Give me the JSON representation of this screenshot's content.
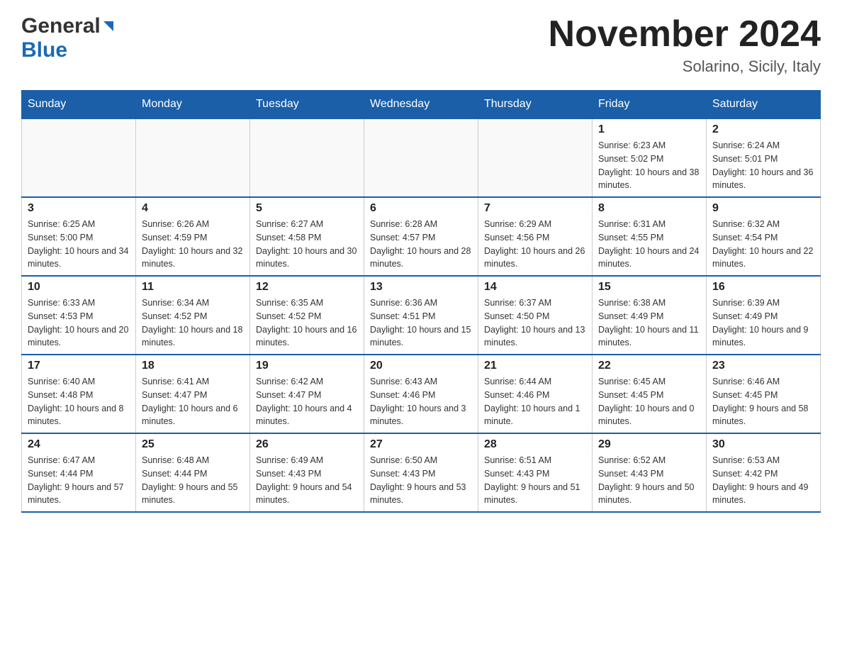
{
  "header": {
    "logo_general": "General",
    "logo_blue": "Blue",
    "month_title": "November 2024",
    "location": "Solarino, Sicily, Italy"
  },
  "weekdays": [
    "Sunday",
    "Monday",
    "Tuesday",
    "Wednesday",
    "Thursday",
    "Friday",
    "Saturday"
  ],
  "weeks": [
    [
      {
        "day": "",
        "sunrise": "",
        "sunset": "",
        "daylight": ""
      },
      {
        "day": "",
        "sunrise": "",
        "sunset": "",
        "daylight": ""
      },
      {
        "day": "",
        "sunrise": "",
        "sunset": "",
        "daylight": ""
      },
      {
        "day": "",
        "sunrise": "",
        "sunset": "",
        "daylight": ""
      },
      {
        "day": "",
        "sunrise": "",
        "sunset": "",
        "daylight": ""
      },
      {
        "day": "1",
        "sunrise": "Sunrise: 6:23 AM",
        "sunset": "Sunset: 5:02 PM",
        "daylight": "Daylight: 10 hours and 38 minutes."
      },
      {
        "day": "2",
        "sunrise": "Sunrise: 6:24 AM",
        "sunset": "Sunset: 5:01 PM",
        "daylight": "Daylight: 10 hours and 36 minutes."
      }
    ],
    [
      {
        "day": "3",
        "sunrise": "Sunrise: 6:25 AM",
        "sunset": "Sunset: 5:00 PM",
        "daylight": "Daylight: 10 hours and 34 minutes."
      },
      {
        "day": "4",
        "sunrise": "Sunrise: 6:26 AM",
        "sunset": "Sunset: 4:59 PM",
        "daylight": "Daylight: 10 hours and 32 minutes."
      },
      {
        "day": "5",
        "sunrise": "Sunrise: 6:27 AM",
        "sunset": "Sunset: 4:58 PM",
        "daylight": "Daylight: 10 hours and 30 minutes."
      },
      {
        "day": "6",
        "sunrise": "Sunrise: 6:28 AM",
        "sunset": "Sunset: 4:57 PM",
        "daylight": "Daylight: 10 hours and 28 minutes."
      },
      {
        "day": "7",
        "sunrise": "Sunrise: 6:29 AM",
        "sunset": "Sunset: 4:56 PM",
        "daylight": "Daylight: 10 hours and 26 minutes."
      },
      {
        "day": "8",
        "sunrise": "Sunrise: 6:31 AM",
        "sunset": "Sunset: 4:55 PM",
        "daylight": "Daylight: 10 hours and 24 minutes."
      },
      {
        "day": "9",
        "sunrise": "Sunrise: 6:32 AM",
        "sunset": "Sunset: 4:54 PM",
        "daylight": "Daylight: 10 hours and 22 minutes."
      }
    ],
    [
      {
        "day": "10",
        "sunrise": "Sunrise: 6:33 AM",
        "sunset": "Sunset: 4:53 PM",
        "daylight": "Daylight: 10 hours and 20 minutes."
      },
      {
        "day": "11",
        "sunrise": "Sunrise: 6:34 AM",
        "sunset": "Sunset: 4:52 PM",
        "daylight": "Daylight: 10 hours and 18 minutes."
      },
      {
        "day": "12",
        "sunrise": "Sunrise: 6:35 AM",
        "sunset": "Sunset: 4:52 PM",
        "daylight": "Daylight: 10 hours and 16 minutes."
      },
      {
        "day": "13",
        "sunrise": "Sunrise: 6:36 AM",
        "sunset": "Sunset: 4:51 PM",
        "daylight": "Daylight: 10 hours and 15 minutes."
      },
      {
        "day": "14",
        "sunrise": "Sunrise: 6:37 AM",
        "sunset": "Sunset: 4:50 PM",
        "daylight": "Daylight: 10 hours and 13 minutes."
      },
      {
        "day": "15",
        "sunrise": "Sunrise: 6:38 AM",
        "sunset": "Sunset: 4:49 PM",
        "daylight": "Daylight: 10 hours and 11 minutes."
      },
      {
        "day": "16",
        "sunrise": "Sunrise: 6:39 AM",
        "sunset": "Sunset: 4:49 PM",
        "daylight": "Daylight: 10 hours and 9 minutes."
      }
    ],
    [
      {
        "day": "17",
        "sunrise": "Sunrise: 6:40 AM",
        "sunset": "Sunset: 4:48 PM",
        "daylight": "Daylight: 10 hours and 8 minutes."
      },
      {
        "day": "18",
        "sunrise": "Sunrise: 6:41 AM",
        "sunset": "Sunset: 4:47 PM",
        "daylight": "Daylight: 10 hours and 6 minutes."
      },
      {
        "day": "19",
        "sunrise": "Sunrise: 6:42 AM",
        "sunset": "Sunset: 4:47 PM",
        "daylight": "Daylight: 10 hours and 4 minutes."
      },
      {
        "day": "20",
        "sunrise": "Sunrise: 6:43 AM",
        "sunset": "Sunset: 4:46 PM",
        "daylight": "Daylight: 10 hours and 3 minutes."
      },
      {
        "day": "21",
        "sunrise": "Sunrise: 6:44 AM",
        "sunset": "Sunset: 4:46 PM",
        "daylight": "Daylight: 10 hours and 1 minute."
      },
      {
        "day": "22",
        "sunrise": "Sunrise: 6:45 AM",
        "sunset": "Sunset: 4:45 PM",
        "daylight": "Daylight: 10 hours and 0 minutes."
      },
      {
        "day": "23",
        "sunrise": "Sunrise: 6:46 AM",
        "sunset": "Sunset: 4:45 PM",
        "daylight": "Daylight: 9 hours and 58 minutes."
      }
    ],
    [
      {
        "day": "24",
        "sunrise": "Sunrise: 6:47 AM",
        "sunset": "Sunset: 4:44 PM",
        "daylight": "Daylight: 9 hours and 57 minutes."
      },
      {
        "day": "25",
        "sunrise": "Sunrise: 6:48 AM",
        "sunset": "Sunset: 4:44 PM",
        "daylight": "Daylight: 9 hours and 55 minutes."
      },
      {
        "day": "26",
        "sunrise": "Sunrise: 6:49 AM",
        "sunset": "Sunset: 4:43 PM",
        "daylight": "Daylight: 9 hours and 54 minutes."
      },
      {
        "day": "27",
        "sunrise": "Sunrise: 6:50 AM",
        "sunset": "Sunset: 4:43 PM",
        "daylight": "Daylight: 9 hours and 53 minutes."
      },
      {
        "day": "28",
        "sunrise": "Sunrise: 6:51 AM",
        "sunset": "Sunset: 4:43 PM",
        "daylight": "Daylight: 9 hours and 51 minutes."
      },
      {
        "day": "29",
        "sunrise": "Sunrise: 6:52 AM",
        "sunset": "Sunset: 4:43 PM",
        "daylight": "Daylight: 9 hours and 50 minutes."
      },
      {
        "day": "30",
        "sunrise": "Sunrise: 6:53 AM",
        "sunset": "Sunset: 4:42 PM",
        "daylight": "Daylight: 9 hours and 49 minutes."
      }
    ]
  ]
}
